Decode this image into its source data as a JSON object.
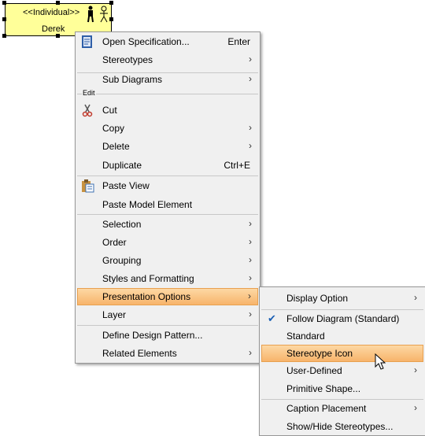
{
  "actor": {
    "stereotype": "<<Individual>>",
    "name": "Derek",
    "icons": [
      "person-silhouette-icon",
      "stick-figure-icon"
    ]
  },
  "main_menu": {
    "open_spec": {
      "label": "Open Specification...",
      "shortcut": "Enter",
      "icon": "specification-icon"
    },
    "stereotypes": {
      "label": "Stereotypes"
    },
    "sub_diagrams": {
      "label": "Sub Diagrams"
    },
    "edit_header": "Edit",
    "cut": {
      "label": "Cut",
      "icon": "scissors-icon"
    },
    "copy": {
      "label": "Copy"
    },
    "delete": {
      "label": "Delete"
    },
    "duplicate": {
      "label": "Duplicate",
      "shortcut": "Ctrl+E"
    },
    "paste_view": {
      "label": "Paste View",
      "icon": "clipboard-icon"
    },
    "paste_model": {
      "label": "Paste Model Element"
    },
    "selection": {
      "label": "Selection"
    },
    "order": {
      "label": "Order"
    },
    "grouping": {
      "label": "Grouping"
    },
    "styles": {
      "label": "Styles and Formatting"
    },
    "presentation": {
      "label": "Presentation Options"
    },
    "layer": {
      "label": "Layer"
    },
    "design_pattern": {
      "label": "Define Design Pattern..."
    },
    "related": {
      "label": "Related Elements"
    }
  },
  "sub_menu": {
    "display_option": {
      "label": "Display Option"
    },
    "follow_diagram": {
      "label": "Follow Diagram (Standard)",
      "checked": true
    },
    "standard": {
      "label": "Standard"
    },
    "stereotype_icon": {
      "label": "Stereotype Icon"
    },
    "user_defined": {
      "label": "User-Defined"
    },
    "primitive_shape": {
      "label": "Primitive Shape..."
    },
    "caption_placement": {
      "label": "Caption Placement"
    },
    "show_hide_stereotypes": {
      "label": "Show/Hide Stereotypes..."
    }
  },
  "colors": {
    "highlight": "#f7b46b",
    "actor_fill": "#ffff99",
    "menu_bg": "#f0f0f0"
  }
}
